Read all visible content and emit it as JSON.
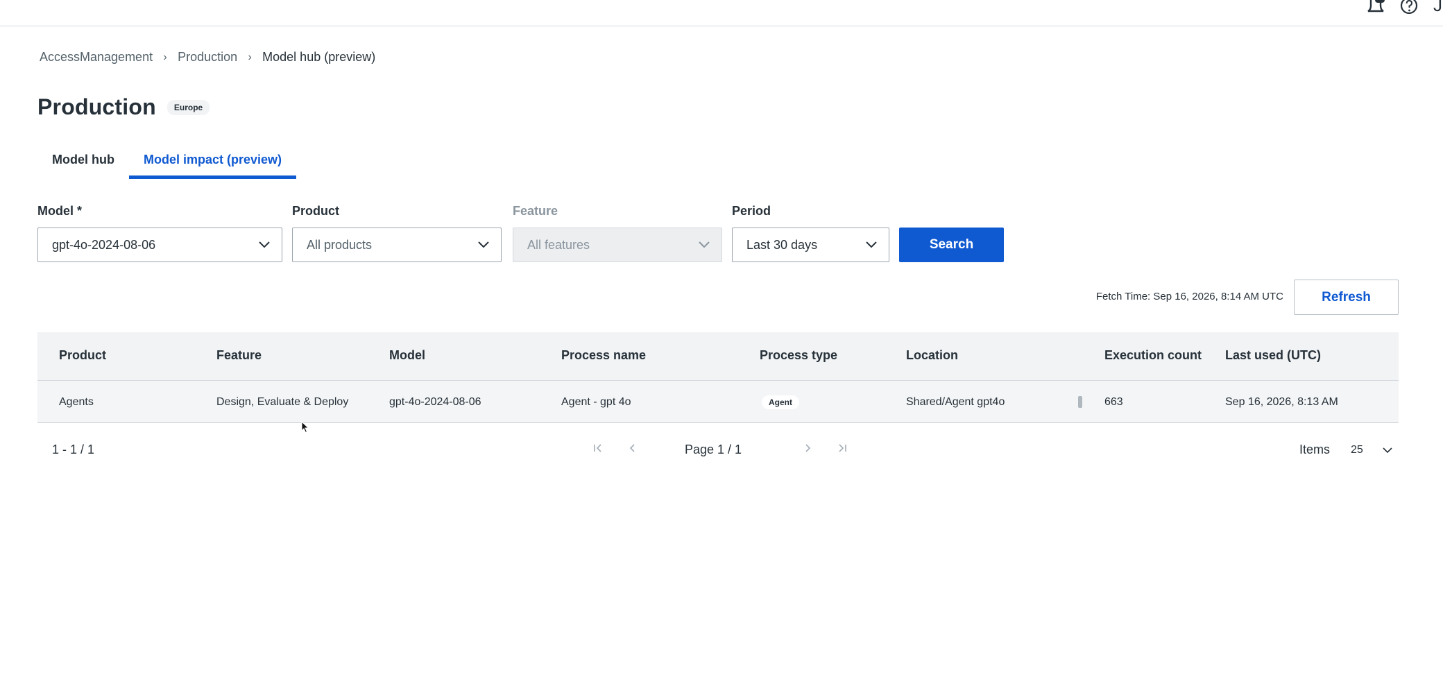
{
  "topbar": {
    "notification_icon": "bell-icon",
    "help_icon": "help-circle-icon",
    "avatar_initial": "J"
  },
  "breadcrumb": [
    {
      "label": "AccessManagement"
    },
    {
      "label": "Production"
    },
    {
      "label": "Model hub (preview)"
    }
  ],
  "page": {
    "title": "Production",
    "region_badge": "Europe"
  },
  "tabs": [
    {
      "label": "Model hub",
      "active": false
    },
    {
      "label": "Model impact (preview)",
      "active": true
    }
  ],
  "filters": {
    "model": {
      "label": "Model *",
      "value": "gpt-4o-2024-08-06"
    },
    "product": {
      "label": "Product",
      "value": "All products"
    },
    "feature": {
      "label": "Feature",
      "value": "All features",
      "disabled": true
    },
    "period": {
      "label": "Period",
      "value": "Last 30 days"
    },
    "search_label": "Search"
  },
  "fetch_time": "Fetch Time: Sep 16, 2026, 8:14 AM UTC",
  "refresh_label": "Refresh",
  "table": {
    "columns": [
      "Product",
      "Feature",
      "Model",
      "Process name",
      "Process type",
      "Location",
      "Execution count",
      "Last used (UTC)"
    ],
    "rows": [
      {
        "product": "Agents",
        "feature": "Design, Evaluate & Deploy",
        "model": "gpt-4o-2024-08-06",
        "process_name": "Agent - gpt 4o",
        "process_type": "Agent",
        "location": "Shared/Agent gpt4o",
        "execution_count": "663",
        "last_used": "Sep 16, 2026, 8:13 AM"
      }
    ]
  },
  "pagination": {
    "range": "1 - 1 / 1",
    "page": "Page 1 / 1",
    "items_label": "Items",
    "items_per_page": "25"
  },
  "colors": {
    "primary": "#0f59d1",
    "text": "#273139",
    "header_bg": "#f1f3f5"
  }
}
